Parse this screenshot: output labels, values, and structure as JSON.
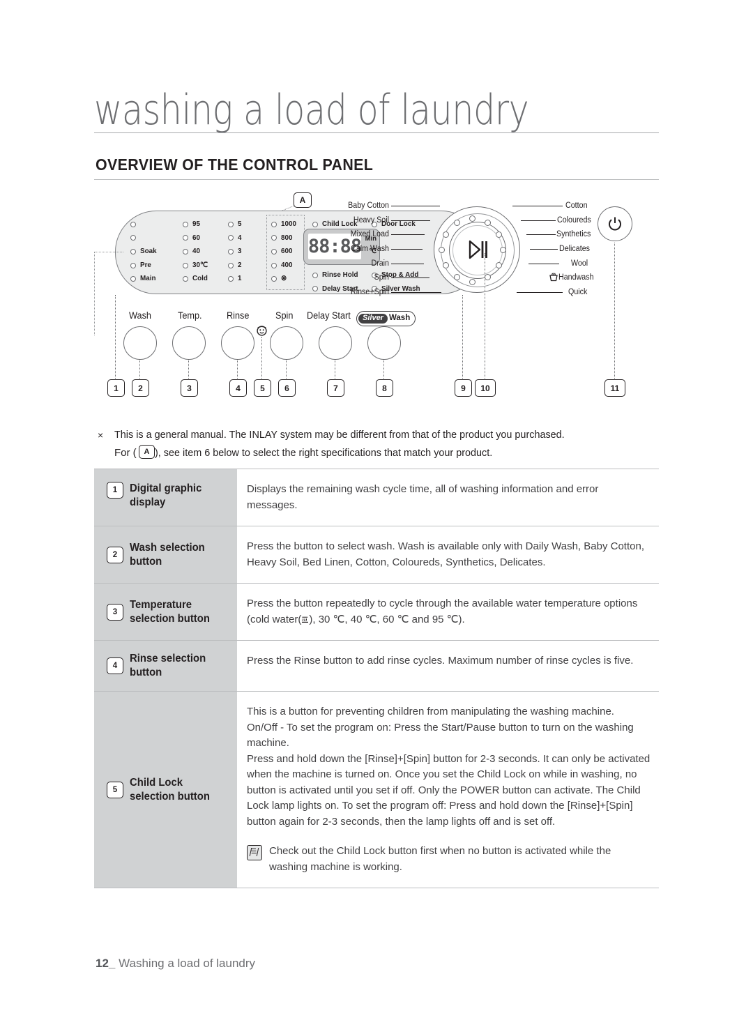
{
  "header": {
    "page_title": "washing a load of laundry",
    "section_title": "OVERVIEW OF THE CONTROL PANEL"
  },
  "diagram": {
    "callout_a": "A",
    "wash_column": [
      "",
      "",
      "Soak",
      "Pre",
      "Main"
    ],
    "temp_column": [
      "95",
      "60",
      "40",
      "30℃",
      "Cold"
    ],
    "rinse_column": [
      "5",
      "4",
      "3",
      "2",
      "1"
    ],
    "spin_column": [
      "1000",
      "800",
      "600",
      "400",
      "⊗"
    ],
    "status_left": [
      "Child Lock",
      "Rinse Hold",
      "Delay Start"
    ],
    "status_right": [
      "Door Lock",
      "Stop & Add",
      "Silver Wash"
    ],
    "display": {
      "digits": "88:88",
      "unit_min": "Min",
      "unit_c": "℃"
    },
    "knob_labels": [
      "Wash",
      "Temp.",
      "Rinse",
      "Spin",
      "Delay Start"
    ],
    "silverwash": {
      "pill": "Silver",
      "tail": "Wash"
    },
    "dial_labels_left": [
      "Baby Cotton",
      "Heavy Soil",
      "Mixed Load",
      "Calm Wash",
      "Drain",
      "Spin",
      "Rinse+Spin"
    ],
    "dial_labels_right": [
      "Cotton",
      "Coloureds",
      "Synthetics",
      "Delicates",
      "Wool",
      "Handwash",
      "Quick"
    ],
    "callout_numbers": [
      "1",
      "2",
      "3",
      "4",
      "5",
      "6",
      "7",
      "8",
      "9",
      "10",
      "11"
    ]
  },
  "note": {
    "marker": "×",
    "line1": "This is a general manual. The INLAY system may be different from that of the product you purchased.",
    "line2_before": "For (",
    "line2_badge": "A",
    "line2_after": "), see item 6 below to select the right specifications that match your product."
  },
  "table": {
    "rows": [
      {
        "num": "1",
        "label_line1": "Digital graphic",
        "label_line2": "display",
        "desc": "Displays the remaining wash cycle time, all of washing information and error messages."
      },
      {
        "num": "2",
        "label_line1": "Wash selection",
        "label_line2": "button",
        "desc": "Press the button to select wash. Wash is available only with Daily Wash, Baby Cotton, Heavy Soil, Bed Linen, Cotton, Coloureds, Synthetics, Delicates."
      },
      {
        "num": "3",
        "label_line1": "Temperature",
        "label_line2": "selection button",
        "desc_before": "Press the button repeatedly to cycle through the available water temperature options (cold water(",
        "desc_after": "), 30 ℃, 40 ℃, 60 ℃ and 95 ℃)."
      },
      {
        "num": "4",
        "label_line1": "Rinse selection",
        "label_line2": "button",
        "desc": "Press the Rinse button to add rinse cycles. Maximum number of rinse cycles is five."
      },
      {
        "num": "5",
        "label_line1": "Child Lock",
        "label_line2": "selection button",
        "para1": "This is a button for preventing children from manipulating the washing machine.",
        "para2": "On/Off - To set the program on: Press the Start/Pause button to turn on the washing machine.",
        "para3": "Press and hold down the  [Rinse]+[Spin] button for 2-3 seconds. It can only be activated when the machine is turned on. Once you set the Child Lock on while in washing, no button is activated until you set if off. Only the POWER button can activate. The Child Lock lamp lights on. To set the program off: Press and hold down the [Rinse]+[Spin] button again for 2-3 seconds, then the lamp lights off and is set off.",
        "note": "Check out the Child Lock button first when no button is activated while the washing machine is working."
      }
    ]
  },
  "footer": {
    "page_number": "12_",
    "text": "Washing a load of laundry"
  }
}
